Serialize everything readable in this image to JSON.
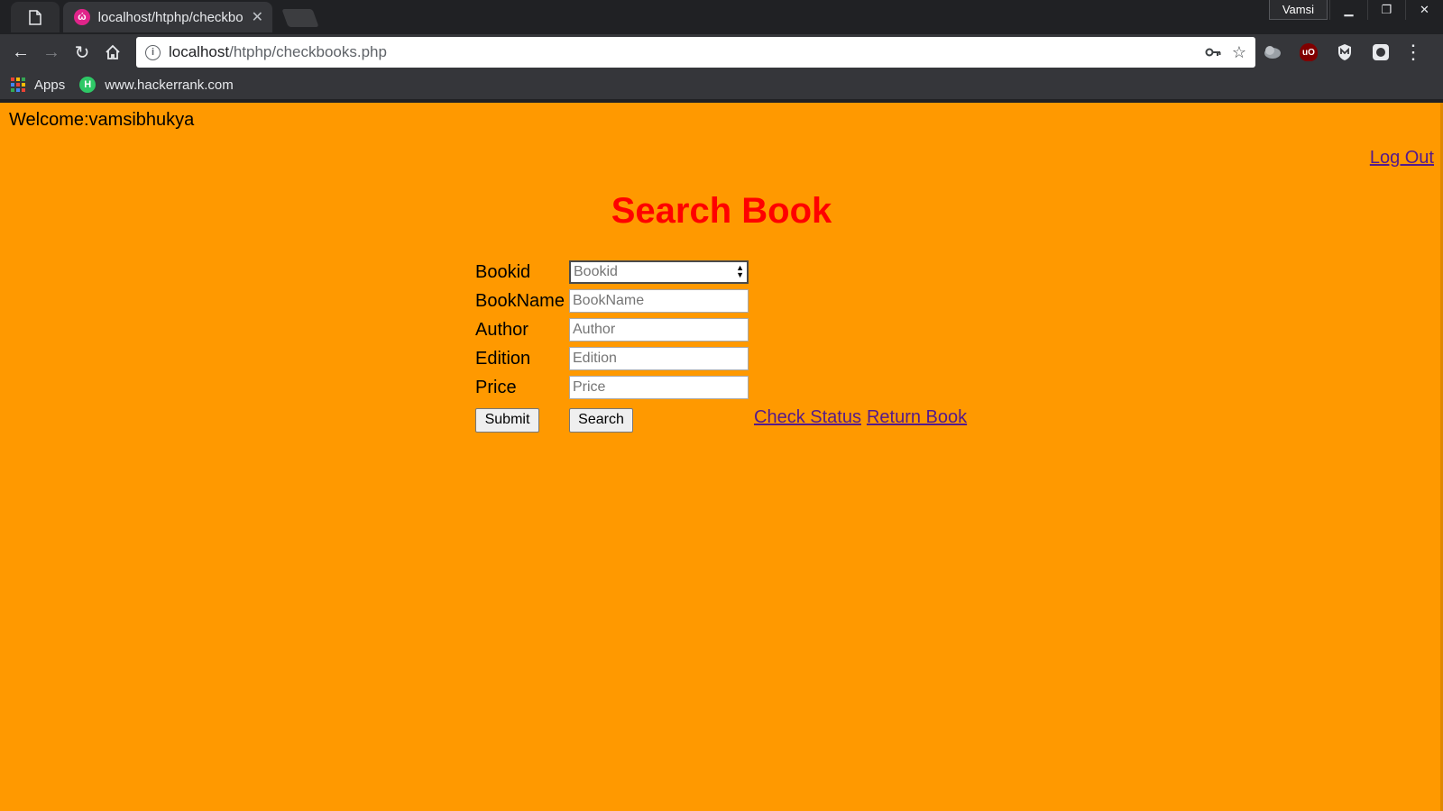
{
  "browser": {
    "tab_title": "localhost/htphp/checkbo",
    "profile_name": "Vamsi",
    "address_host": "localhost",
    "address_path": "/htphp/checkbooks.php",
    "bookmarks": [
      {
        "label": "Apps",
        "icon": "apps-grid-icon"
      },
      {
        "label": "www.hackerrank.com",
        "icon": "hackerrank-icon"
      }
    ],
    "favicon_letter": "ώ",
    "hackerrank_letter": "H",
    "extensions": [
      {
        "icon": "cloud-extension-icon",
        "color": "#9aa0a6"
      },
      {
        "icon": "ublock-origin-icon",
        "color": "#800000",
        "text": "uO"
      },
      {
        "icon": "malwarebytes-shield-icon",
        "color": "#e8eaed"
      },
      {
        "icon": "octotree-extension-icon",
        "color": "#e8eaed"
      }
    ]
  },
  "page": {
    "welcome": "Welcome:vamsibhukya",
    "logout": "Log Out",
    "heading": "Search Book",
    "background_color": "#ff9900",
    "heading_color": "#ff0000",
    "fields": [
      {
        "label": "Bookid",
        "placeholder": "Bookid"
      },
      {
        "label": "BookName",
        "placeholder": "BookName"
      },
      {
        "label": "Author",
        "placeholder": "Author"
      },
      {
        "label": "Edition",
        "placeholder": "Edition"
      },
      {
        "label": "Price",
        "placeholder": "Price"
      }
    ],
    "submit_label": "Submit",
    "search_label": "Search",
    "check_status": "Check Status",
    "return_book": "Return Book"
  }
}
